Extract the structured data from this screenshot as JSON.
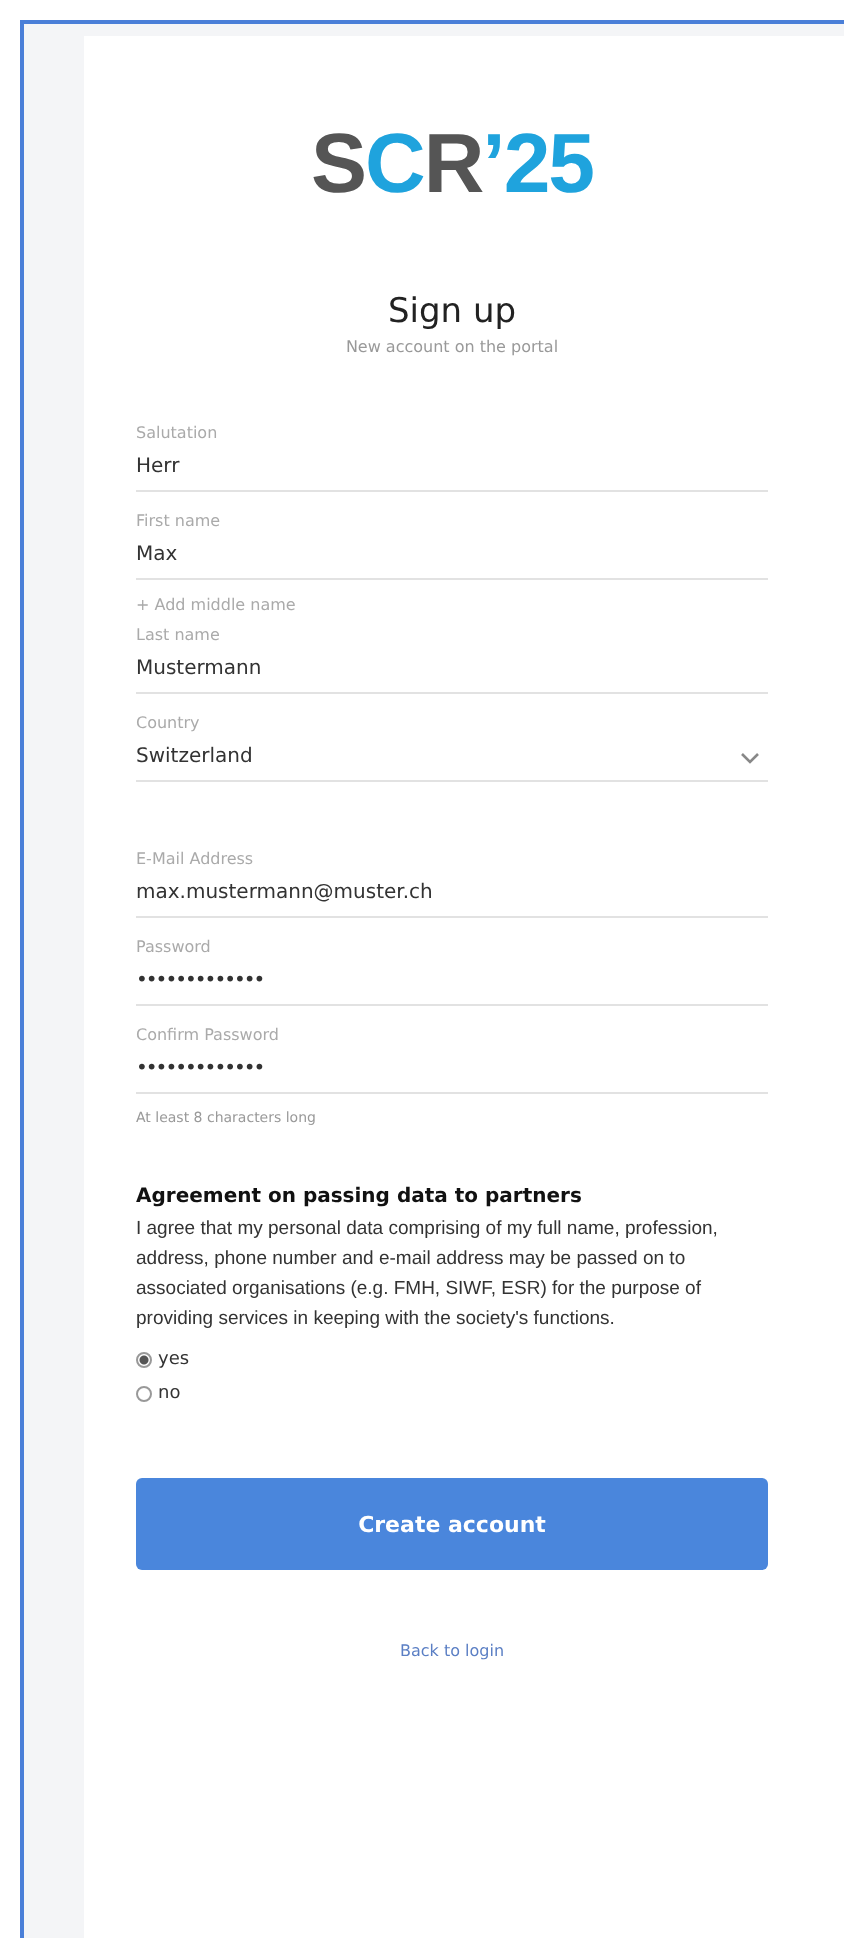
{
  "logo": {
    "letters": [
      {
        "text": "S",
        "kind": "dark"
      },
      {
        "text": "C",
        "kind": "accent"
      },
      {
        "text": "R",
        "kind": "dark"
      },
      {
        "text": "’25",
        "kind": "accent"
      }
    ]
  },
  "title": "Sign up",
  "subtitle": "New account on the portal",
  "fields": [
    {
      "kind": "text",
      "label": "Salutation",
      "value": "Herr"
    },
    {
      "kind": "text",
      "label": "First name",
      "value": "Max"
    },
    {
      "kind": "link",
      "text": "+ Add middle name"
    },
    {
      "kind": "text",
      "label": "Last name",
      "value": "Mustermann"
    },
    {
      "kind": "select",
      "label": "Country",
      "value": "Switzerland"
    },
    {
      "kind": "spacer"
    },
    {
      "kind": "text",
      "label": "E-Mail Address",
      "value": "max.mustermann@muster.ch"
    },
    {
      "kind": "password",
      "label": "Password",
      "value": "•••••••••••••"
    },
    {
      "kind": "password",
      "label": "Confirm Password",
      "value": "•••••••••••••"
    },
    {
      "kind": "hint",
      "text": "At least 8 characters long"
    }
  ],
  "agreement": {
    "heading": "Agreement on passing data to partners",
    "text": "I agree that my personal data comprising of my full name, profession, address, phone number and e-mail address may be passed on to associated organisations (e.g. FMH, SIWF, ESR) for the purpose of providing services in keeping with the society's functions.",
    "options": [
      {
        "label": "yes",
        "selected": true
      },
      {
        "label": "no",
        "selected": false
      }
    ]
  },
  "submit": "Create account",
  "back_link": "Back to login"
}
